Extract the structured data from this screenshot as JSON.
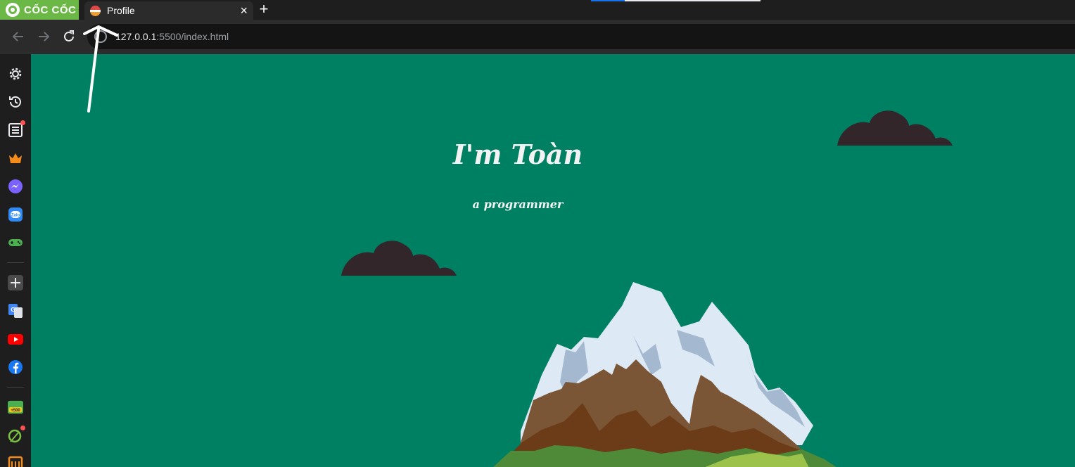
{
  "browser": {
    "brand": "CỐC CỐC",
    "tab": {
      "title": "Profile",
      "close": "×"
    },
    "new_tab": "+",
    "address": {
      "host": "127.0.0.1",
      "path": ":5500/index.html"
    }
  },
  "sidebar": {
    "items": [
      {
        "name": "settings",
        "icon": "gear-icon"
      },
      {
        "name": "history",
        "icon": "history-icon"
      },
      {
        "name": "reading-list",
        "icon": "list-icon",
        "badge": true
      },
      {
        "name": "crown",
        "icon": "crown-icon"
      },
      {
        "name": "messenger",
        "icon": "messenger-icon"
      },
      {
        "name": "zalo",
        "icon": "zalo-icon",
        "label": "Zalo"
      },
      {
        "name": "games",
        "icon": "gamepad-icon"
      },
      {
        "name": "add",
        "icon": "plus-icon"
      },
      {
        "name": "translate",
        "icon": "translate-icon"
      },
      {
        "name": "youtube",
        "icon": "youtube-icon"
      },
      {
        "name": "facebook",
        "icon": "facebook-icon"
      },
      {
        "name": "rewards",
        "icon": "rewards-icon",
        "label": "+500"
      },
      {
        "name": "coccoc-extra",
        "icon": "leaf-icon",
        "badge": true
      },
      {
        "name": "shop",
        "icon": "shop-icon"
      }
    ]
  },
  "page": {
    "title": "I'm Toàn",
    "subtitle": "a programmer",
    "colors": {
      "background": "#008063",
      "cloud": "#33262b",
      "snow": "#dde9f5",
      "rock": "#7a5536",
      "grass": "#4e8a37"
    }
  }
}
